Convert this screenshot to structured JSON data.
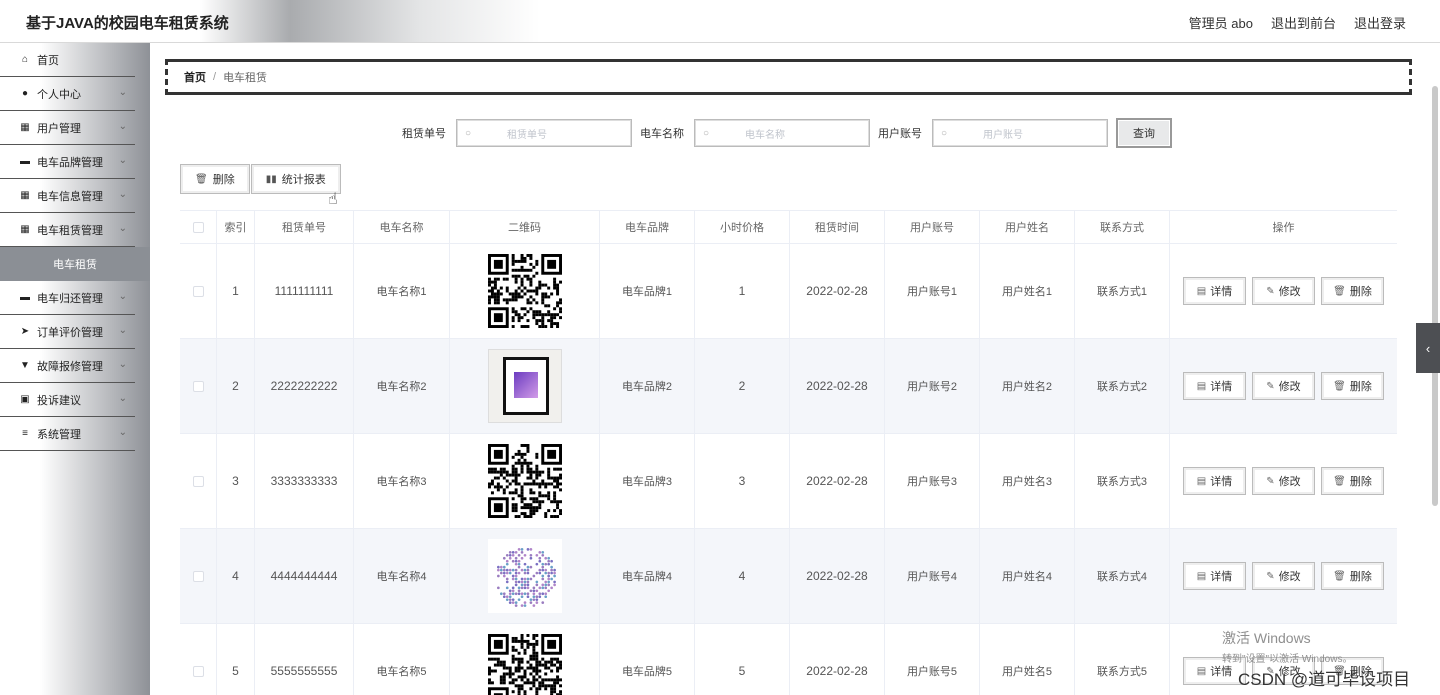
{
  "app": {
    "title": "基于JAVA的校园电车租赁系统"
  },
  "header": {
    "user": "管理员 abo",
    "front_link": "退出到前台",
    "logout": "退出登录"
  },
  "sidebar": {
    "items": [
      {
        "label": "首页",
        "icon": "home-icon"
      },
      {
        "label": "个人中心",
        "icon": "person-icon"
      },
      {
        "label": "用户管理",
        "icon": "grid-icon"
      },
      {
        "label": "电车品牌管理",
        "icon": "car-icon"
      },
      {
        "label": "电车信息管理",
        "icon": "grid-icon"
      },
      {
        "label": "电车租赁管理",
        "icon": "grid-icon"
      },
      {
        "label": "电车租赁",
        "icon": ""
      },
      {
        "label": "电车归还管理",
        "icon": "car-icon"
      },
      {
        "label": "订单评价管理",
        "icon": "send-icon"
      },
      {
        "label": "故障报修管理",
        "icon": "tool-icon"
      },
      {
        "label": "投诉建议",
        "icon": "clipboard-icon"
      },
      {
        "label": "系统管理",
        "icon": "list-icon"
      }
    ]
  },
  "breadcrumb": {
    "home": "首页",
    "sep": "/",
    "current": "电车租赁"
  },
  "search": {
    "rent_no_label": "租赁单号",
    "rent_no_placeholder": "租赁单号",
    "car_name_label": "电车名称",
    "car_name_placeholder": "电车名称",
    "user_account_label": "用户账号",
    "user_account_placeholder": "用户账号",
    "query_button": "查询"
  },
  "toolbar": {
    "delete": "删除",
    "report": "统计报表"
  },
  "table": {
    "headers": [
      "索引",
      "租赁单号",
      "电车名称",
      "二维码",
      "电车品牌",
      "小时价格",
      "租赁时间",
      "用户账号",
      "用户姓名",
      "联系方式",
      "操作"
    ],
    "rows": [
      {
        "index": "1",
        "rent_no": "1111111111",
        "car_name": "电车名称1",
        "brand": "电车品牌1",
        "price": "1",
        "time": "2022-02-28",
        "account": "用户账号1",
        "name": "用户姓名1",
        "contact": "联系方式1"
      },
      {
        "index": "2",
        "rent_no": "2222222222",
        "car_name": "电车名称2",
        "brand": "电车品牌2",
        "price": "2",
        "time": "2022-02-28",
        "account": "用户账号2",
        "name": "用户姓名2",
        "contact": "联系方式2"
      },
      {
        "index": "3",
        "rent_no": "3333333333",
        "car_name": "电车名称3",
        "brand": "电车品牌3",
        "price": "3",
        "time": "2022-02-28",
        "account": "用户账号3",
        "name": "用户姓名3",
        "contact": "联系方式3"
      },
      {
        "index": "4",
        "rent_no": "4444444444",
        "car_name": "电车名称4",
        "brand": "电车品牌4",
        "price": "4",
        "time": "2022-02-28",
        "account": "用户账号4",
        "name": "用户姓名4",
        "contact": "联系方式4"
      },
      {
        "index": "5",
        "rent_no": "5555555555",
        "car_name": "电车名称5",
        "brand": "电车品牌5",
        "price": "5",
        "time": "2022-02-28",
        "account": "用户账号5",
        "name": "用户姓名5",
        "contact": "联系方式5"
      }
    ],
    "actions": {
      "detail": "详情",
      "edit": "修改",
      "delete": "删除"
    }
  },
  "watermark": {
    "line1": "激活 Windows",
    "line2": "转到\"设置\"以激活 Windows。",
    "csdn": "CSDN @道可毕设项目"
  }
}
